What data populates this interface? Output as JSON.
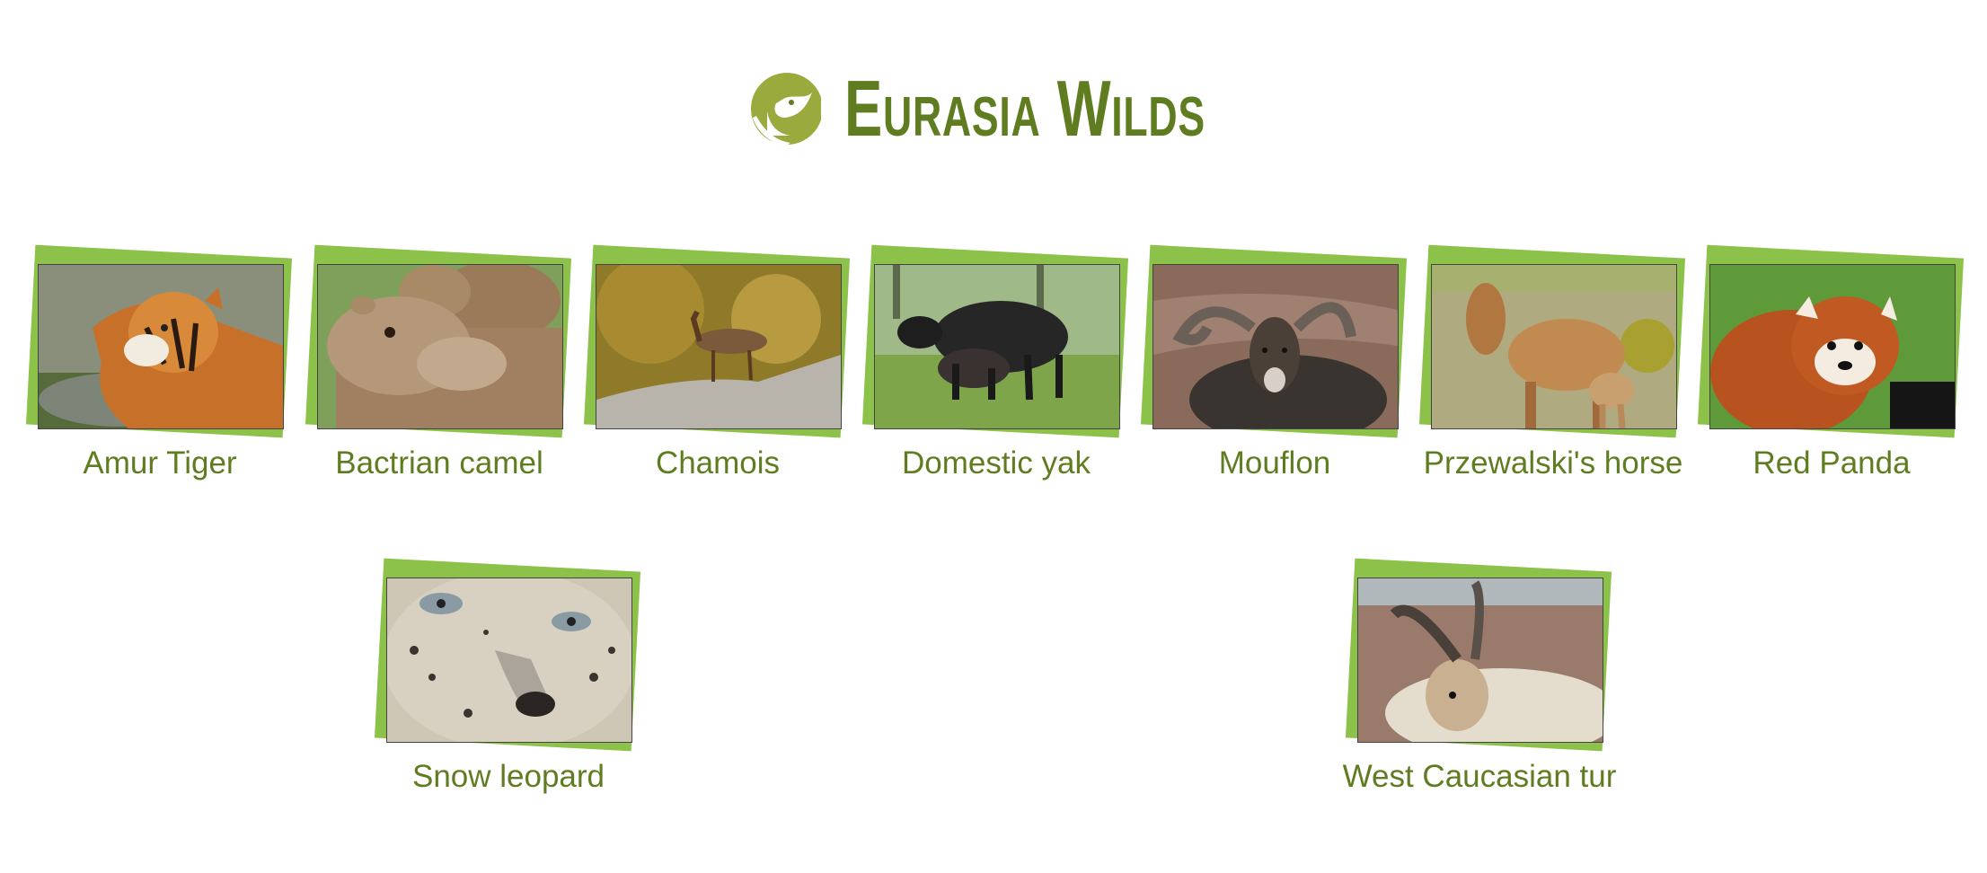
{
  "header": {
    "title": "Eurasia Wilds",
    "logo_icon": "bird-logo-icon",
    "accent_color": "#5f7d20",
    "frame_color": "#8cc24a"
  },
  "animals": [
    {
      "name": "Amur Tiger",
      "icon": "tiger-photo"
    },
    {
      "name": "Bactrian camel",
      "icon": "camel-photo"
    },
    {
      "name": "Chamois",
      "icon": "chamois-photo"
    },
    {
      "name": "Domestic yak",
      "icon": "yak-photo"
    },
    {
      "name": "Mouflon",
      "icon": "mouflon-photo"
    },
    {
      "name": "Przewalski's horse",
      "icon": "horse-photo"
    },
    {
      "name": "Red Panda",
      "icon": "red-panda-photo"
    },
    {
      "name": "Snow leopard",
      "icon": "snow-leopard-photo"
    },
    {
      "name": "West Caucasian tur",
      "icon": "tur-photo"
    }
  ]
}
